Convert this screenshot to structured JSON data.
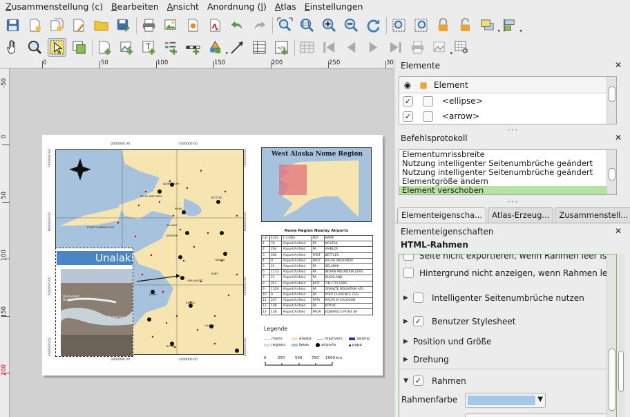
{
  "menu": [
    {
      "pre": "",
      "acc": "Z",
      "post": "usammenstellung (c)"
    },
    {
      "pre": "",
      "acc": "B",
      "post": "earbeiten"
    },
    {
      "pre": "",
      "acc": "A",
      "post": "nsicht"
    },
    {
      "pre": "Anordnung (",
      "acc": "l",
      "post": ")"
    },
    {
      "pre": "",
      "acc": "A",
      "post": "tlas"
    },
    {
      "pre": "",
      "acc": "E",
      "post": "instellungen"
    }
  ],
  "ruler_top": [
    "0",
    "50",
    "100",
    "150",
    "200",
    "250",
    "300"
  ],
  "ruler_left": [
    "-50",
    "0",
    "50",
    "100",
    "150",
    "200"
  ],
  "map": {
    "coords_top": [
      "-2000000.00",
      "-1000000.00"
    ],
    "coords_bottom": [
      "-2000000.00",
      "-1000000.00"
    ],
    "coords_left": [
      "7000000.00",
      "6000000.00",
      "5000000.00",
      "4000000.00"
    ],
    "coords_right": [
      "7000000.00",
      "6000000.00",
      "5000000.00",
      "4000000.00"
    ],
    "place_labels": [
      "WAINWRIGHT",
      "RALPH WIEN MEM",
      "KIANA",
      "POINT CLARENCE CGS",
      "BETTLES",
      "NOME",
      "SELAWIK",
      "NOORVIK",
      "UNALAKLEET",
      "TANANA",
      "KALTAG",
      "GALENA",
      "RUBY",
      "BETHEL"
    ]
  },
  "inset_title": "West Alaska Nome Region",
  "table": {
    "title": "Nome Region Nearby Airports",
    "headers": [
      "cat",
      "ELEV",
      "F_CODE",
      "IKO",
      "NAME"
    ],
    "rows": [
      [
        "1",
        "78",
        "Airport/Airfield",
        "PA",
        "NOATAK"
      ],
      [
        "2",
        "264",
        "Airport/Airfield",
        "PA",
        "AMBLER"
      ],
      [
        "3",
        "585",
        "Airport/Airfield",
        "PABT",
        "BETTLES"
      ],
      [
        "4",
        "9",
        "Airport/Airfield",
        "PAOT",
        "RALPH WIEN MEM"
      ],
      [
        "5",
        "21",
        "Airport/Airfield",
        "PA",
        "SELAWIK"
      ],
      [
        "6",
        "1113",
        "Airport/Airfield",
        "PA",
        "INDIAN MOUNTAIN LRRS"
      ],
      [
        "7",
        "21",
        "Airport/Airfield",
        "PA",
        "BUCKLAND"
      ],
      [
        "8",
        "243",
        "Airport/Airfield",
        "PATC",
        "TIN CITY LRRS"
      ],
      [
        "9",
        "1329",
        "Airport/Airfield",
        "PA",
        "GRANITE MOUNTAIN AFS"
      ],
      [
        "10",
        "9",
        "Airport/Airfield",
        "PA",
        "PORT CLARENCE CGS"
      ],
      [
        "11",
        "207",
        "Airport/Airfield",
        "PATA",
        "RALPH M CALHOUN"
      ],
      [
        "12",
        "108",
        "Airport/Airfield",
        "PA",
        "KOYUK"
      ],
      [
        "13",
        "138",
        "Airport/Airfield",
        "PAGA",
        "EDWARD G PITKA SR"
      ]
    ]
  },
  "legend": {
    "title": "Legende",
    "items": [
      {
        "label": "rivers",
        "color": "#9fc5e8"
      },
      {
        "label": "alaska",
        "color": "#f7e5b1"
      },
      {
        "label": "majrivers",
        "color": "#7aa7d6"
      },
      {
        "label": "swamp",
        "color": "#333399"
      },
      {
        "label": "regions",
        "color": "#dddddd"
      },
      {
        "label": "lakes",
        "color": "#a6c2dc"
      },
      {
        "label": "airports",
        "color": "#000000"
      },
      {
        "label": "popp",
        "color": "#b00000"
      }
    ],
    "scale_labels": [
      "0",
      "250",
      "500",
      "750",
      "1000 km"
    ]
  },
  "photo": {
    "title": "Unalakleet",
    "sub": "UNA",
    "caption_a": "Unalakleet River",
    "caption_b": "Bering Sea"
  },
  "elements_panel": {
    "title": "Elemente",
    "col": "Element",
    "rows": [
      "<ellipse>",
      "<arrow>"
    ]
  },
  "history_panel": {
    "title": "Befehlsprotokoll",
    "rows": [
      "Elementumrissbreite",
      "Nutzung intelligenter Seitenumbrüche geändert",
      "Nutzung intelligenter Seitenumbrüche geändert",
      "Elementgröße ändern",
      "Element verschoben"
    ],
    "selected": 4
  },
  "tabs": [
    "Elementeigenscha...",
    "Atlas-Erzeug...",
    "Zusammenstell..."
  ],
  "props": {
    "dock_title": "Elementeigenschaften",
    "section": "HTML-Rahmen",
    "opt_no_export": "Seite nicht exportieren, wenn Rahmen leer ist",
    "opt_no_bg": "Hintergrund nicht anzeigen, wenn Rahmen leer ist",
    "opt_smart_breaks": "Intelligenter Seitenumbrüche nutzen",
    "opt_user_stylesheet": "Benutzer Stylesheet",
    "grp_position": "Position und Größe",
    "grp_rotation": "Drehung",
    "grp_frame": "Rahmen",
    "frame_color_label": "Rahmenfarbe",
    "frame_color": "#a6c8e8"
  },
  "close_glyph": "✕"
}
